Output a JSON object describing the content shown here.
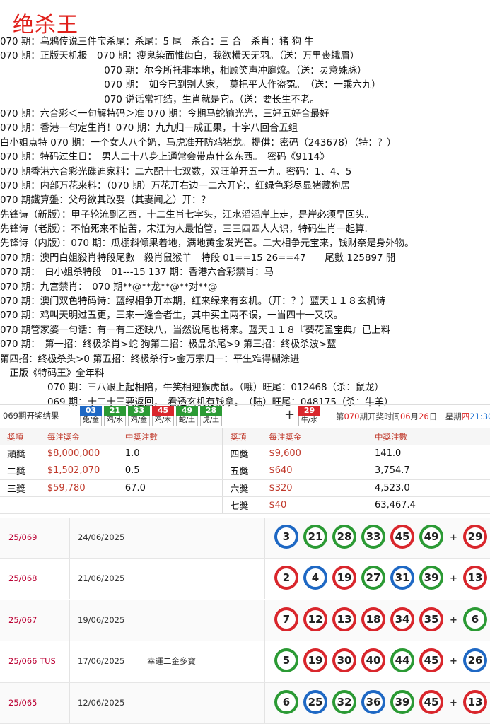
{
  "title": "绝杀王",
  "lines": [
    "070 期：乌鸦传说三件宝杀尾：杀尾：5 尾　杀合：三 合　杀肖：猪 狗 牛",
    "070 期：正版天机报　070 期：瘦鬼染面惟齿白，我欲横天无羽。（送：万里丧蛾眉）",
    "　　　　　　　　　　　070 期：尔今所托非本地，相顾笑声冲庭燎。（送：灵意殊脉）",
    "　　　　　　　　　　　070 期：　如今已到别人家，　莫把平人作盗冤。　（送：一乘六九）",
    "　　　　　　　　　　　070 说话常打结，生肖就是它。（送：要长生不老。",
    "070 期：六合彩＜一句解特码＞准 070 期：今期马蛇输光光，三好五好合最好",
    "070 期：香港一句定生肖！070 期：九九归一成正果，十字八回合五组",
    "白小姐点特 070 期：一个女人八个奶，马虎准开防鸡猪龙。提供：密码（243678）（特：？）",
    "070 期：特码过生日：　男人二十八身上通常会带点什么东西。　密码《9114》",
    "070 期香港六合彩光碟迪家料：二六配十七双数，双旺单开五一九。密码：1、4、5",
    "070 期：内部万花来料：（070 期）万花开右边一二六开它，红绿色彩尽显猪藏狗居",
    "070 期鐵算盤：父母欲其改娶（其妻闻之）开：？",
    "先锋诗（新版）：甲子轮流到乙酉，十二生肖七字头，江水滔滔岸上走，是岸必须早回头。",
    "先锋诗（老版）：不怕死来不怕苦，宋江为人最怕管，三三四四人人识，特码生肖一起算.",
    "先锋诗（内版）：070 期：瓜棚斜倾果着地，满地黄金发光芒。二大相争元宝来，钱财奈是身外物。",
    "070 期：澳門白姐殺肖特段尾數　殺肖鼠猴羊　特段 01==15 26==47　　尾數 125897 開",
    "070 期：　白小姐杀特段　01---15 137 期：香港六合彩禁肖：马",
    "070 期：九宫禁肖：　070 期**@**龙**@**对**@",
    "070 期：澳门双色特码诗：蓝绿相争开本期，红来绿来有玄机。（开：？）蓝天１１８玄机诗",
    "070 期：鸡叫天明过五更，三来一逢合者生，其中买主两不误，一当四十一又叹。",
    "070 期管家婆一句话：有一有二还缺八，当然说尾也将来。蓝天１１８『葵花圣宝典』已上料",
    "070 期：　第一招：终极杀肖>蛇 狗第二招：极品杀尾>9 第三招：终极杀波>蓝",
    "第四招：终极杀头>0 第五招：终极杀行>金万宗归一：平生难得糊涂进",
    "　正版《特码王》全年料",
    "　　　　　070 期：三八跟上起相陪，牛笑相迎猴虎鼠。（哦）旺尾：012468（杀：鼠龙）",
    "　　　　　069 期：十二十三要返回，　看透玄机有钱拿。　（陆）旺尾：048175（杀：牛羊）"
  ],
  "results_bar": {
    "label": "069期开奖结果",
    "balls": [
      {
        "num": "03",
        "zodiac": "兔/金",
        "color": "#1e68c4"
      },
      {
        "num": "21",
        "zodiac": "鸡/水",
        "color": "#2b9a34"
      },
      {
        "num": "33",
        "zodiac": "鸡/金",
        "color": "#2b9a34"
      },
      {
        "num": "45",
        "zodiac": "鸡/木",
        "color": "#d9262c"
      },
      {
        "num": "49",
        "zodiac": "蛇/土",
        "color": "#2b9a34"
      },
      {
        "num": "28",
        "zodiac": "虎/土",
        "color": "#2b9a34"
      }
    ],
    "plus": "+",
    "special": {
      "num": "29",
      "zodiac": "牛/水",
      "color": "#d9262c"
    },
    "next_prefix": "第",
    "next_period": "070",
    "next_mid": "期开奖时间",
    "next_month": "06",
    "next_m": "月",
    "next_day": "26",
    "next_d": "日　星期",
    "next_weekday": "四",
    "next_time": "21:30"
  },
  "prize_table": {
    "headers": [
      "獎項",
      "每注獎金",
      "中獎注數",
      "獎項",
      "每注獎金",
      "中獎注數"
    ],
    "rows": [
      [
        "頭獎",
        "$8,000,000",
        "1.0",
        "四獎",
        "$9,600",
        "141.0"
      ],
      [
        "二獎",
        "$1,502,070",
        "0.5",
        "五獎",
        "$640",
        "3,754.7"
      ],
      [
        "三獎",
        "$59,780",
        "67.0",
        "六獎",
        "$320",
        "4,523.0"
      ],
      [
        "",
        "",
        "",
        "七獎",
        "$40",
        "63,467.4"
      ]
    ]
  },
  "history": [
    {
      "issue": "25/069",
      "date": "24/06/2025",
      "note": "",
      "balls": [
        [
          "3",
          "blue"
        ],
        [
          "21",
          "green"
        ],
        [
          "28",
          "green"
        ],
        [
          "33",
          "green"
        ],
        [
          "45",
          "red"
        ],
        [
          "49",
          "green"
        ]
      ],
      "special": [
        "29",
        "red"
      ]
    },
    {
      "issue": "25/068",
      "date": "21/06/2025",
      "note": "",
      "balls": [
        [
          "2",
          "red"
        ],
        [
          "4",
          "blue"
        ],
        [
          "19",
          "red"
        ],
        [
          "27",
          "green"
        ],
        [
          "31",
          "blue"
        ],
        [
          "39",
          "green"
        ]
      ],
      "special": [
        "13",
        "red"
      ]
    },
    {
      "issue": "25/067",
      "date": "19/06/2025",
      "note": "",
      "balls": [
        [
          "7",
          "red"
        ],
        [
          "12",
          "red"
        ],
        [
          "13",
          "red"
        ],
        [
          "18",
          "red"
        ],
        [
          "34",
          "red"
        ],
        [
          "35",
          "red"
        ]
      ],
      "special": [
        "6",
        "green"
      ]
    },
    {
      "issue": "25/066 TUS",
      "date": "17/06/2025",
      "note": "幸運二金多寶",
      "balls": [
        [
          "5",
          "green"
        ],
        [
          "19",
          "red"
        ],
        [
          "30",
          "red"
        ],
        [
          "40",
          "red"
        ],
        [
          "44",
          "green"
        ],
        [
          "45",
          "red"
        ]
      ],
      "special": [
        "26",
        "blue"
      ]
    },
    {
      "issue": "25/065",
      "date": "12/06/2025",
      "note": "",
      "balls": [
        [
          "6",
          "green"
        ],
        [
          "25",
          "blue"
        ],
        [
          "32",
          "green"
        ],
        [
          "36",
          "blue"
        ],
        [
          "39",
          "green"
        ],
        [
          "45",
          "red"
        ]
      ],
      "special": [
        "13",
        "red"
      ]
    }
  ],
  "history_plus": "+"
}
